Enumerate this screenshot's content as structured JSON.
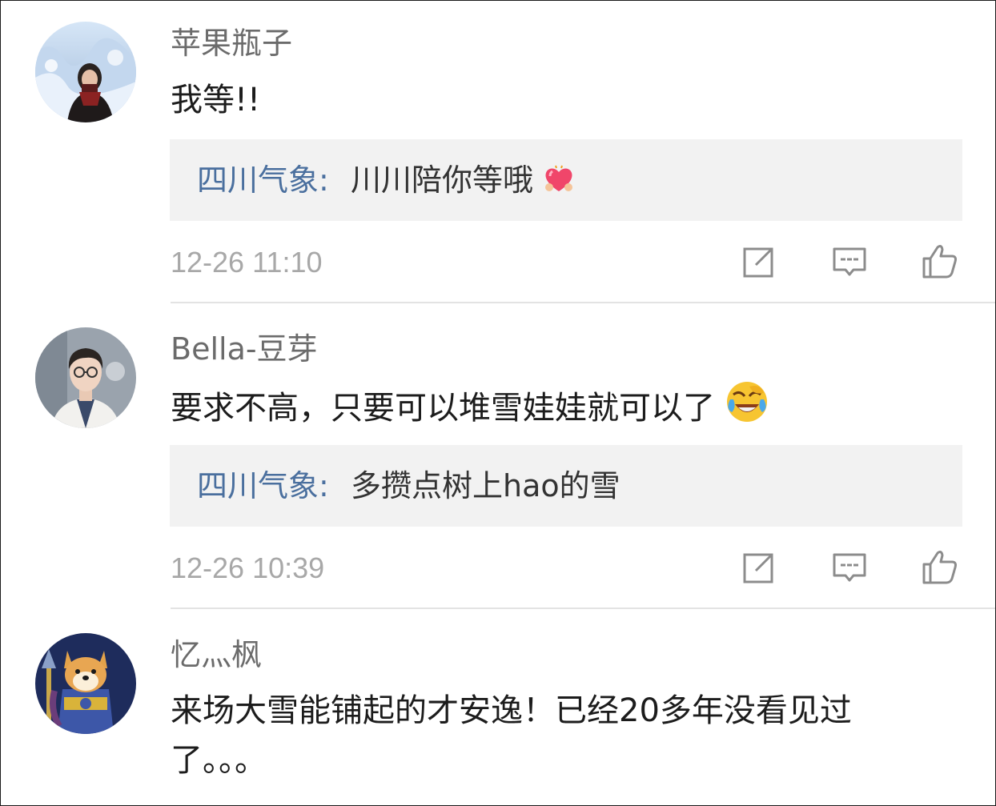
{
  "comments": [
    {
      "username": "苹果瓶子",
      "text": "我等!!",
      "reply_author": "四川气象",
      "reply_separator": ":",
      "reply_text": "川川陪你等哦",
      "timestamp": "12-26 11:10"
    },
    {
      "username": "Bella-豆芽",
      "text": "要求不高，只要可以堆雪娃娃就可以了",
      "reply_author": "四川气象",
      "reply_separator": ":",
      "reply_text": "多攒点树上hao的雪",
      "timestamp": "12-26 10:39"
    },
    {
      "username": "忆灬枫",
      "text": "来场大雪能铺起的才安逸！已经20多年没看见过了。。。"
    }
  ],
  "icons": {
    "share": "share-icon",
    "comment": "comment-icon",
    "like": "thumbs-up-icon",
    "heart_emoji": "heart-emoji-icon",
    "laugh_cry_emoji": "laugh-cry-emoji-icon"
  },
  "colors": {
    "reply_author": "#4a6f9e",
    "reply_background": "#f2f2f2",
    "timestamp": "#a8a8a8",
    "username": "#6b6b6b"
  }
}
